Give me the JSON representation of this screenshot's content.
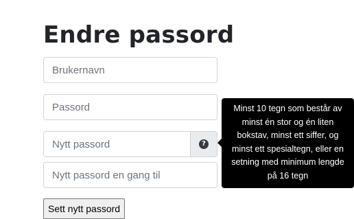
{
  "page": {
    "title": "Endre passord"
  },
  "form": {
    "username_placeholder": "Brukernavn",
    "password_placeholder": "Passord",
    "new_password_placeholder": "Nytt passord",
    "confirm_placeholder": "Nytt passord en gang til",
    "help_icon_glyph": "?",
    "submit_label": "Sett nytt passord"
  },
  "tooltip": {
    "text": "Minst 10 tegn som består av minst én stor og én liten bokstav, minst ett siffer, og minst ett spesialtegn, eller en setning med minimum lengde på 16 tegn"
  },
  "icons": {
    "help": "question-circle-icon"
  },
  "colors": {
    "tooltip_background": "#000000",
    "addon_background": "#e9ecef",
    "input_border": "#ced4da"
  }
}
